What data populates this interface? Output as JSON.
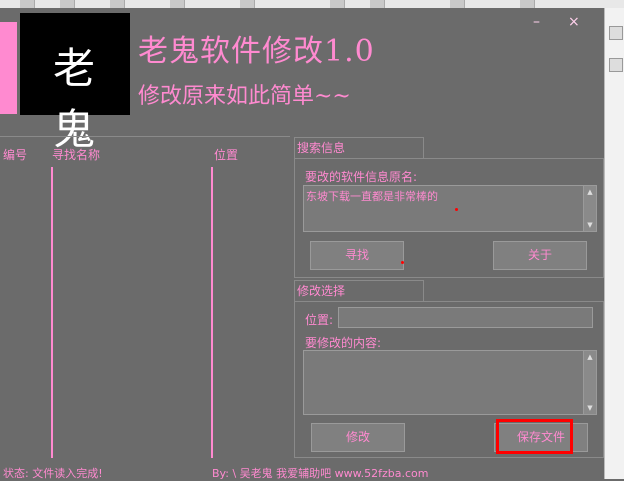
{
  "header": {
    "logo_text": "老 鬼",
    "title": "老鬼软件修改1.0",
    "subtitle": "修改原来如此简单~~",
    "minimize": "–",
    "close": "×"
  },
  "list": {
    "columns": [
      "编号",
      "寻找名称",
      "位置"
    ]
  },
  "search": {
    "section_label": "搜索信息",
    "field_label": "要改的软件信息原名:",
    "field_value": "东坡下载一直都是非常棒的",
    "find_button": "寻找",
    "about_button": "关于"
  },
  "modify": {
    "section_label": "修改选择",
    "position_label": "位置:",
    "position_value": "",
    "content_label": "要修改的内容:",
    "content_value": "",
    "modify_button": "修改",
    "save_button": "保存文件"
  },
  "status": {
    "text": "状态: 文件读入完成!",
    "author": "By: \\ 吴老鬼  我爱辅助吧 www.52fzba.com"
  },
  "colors": {
    "accent": "#ff8ad0",
    "background": "#6b6b6b",
    "highlight": "#ff0000"
  }
}
